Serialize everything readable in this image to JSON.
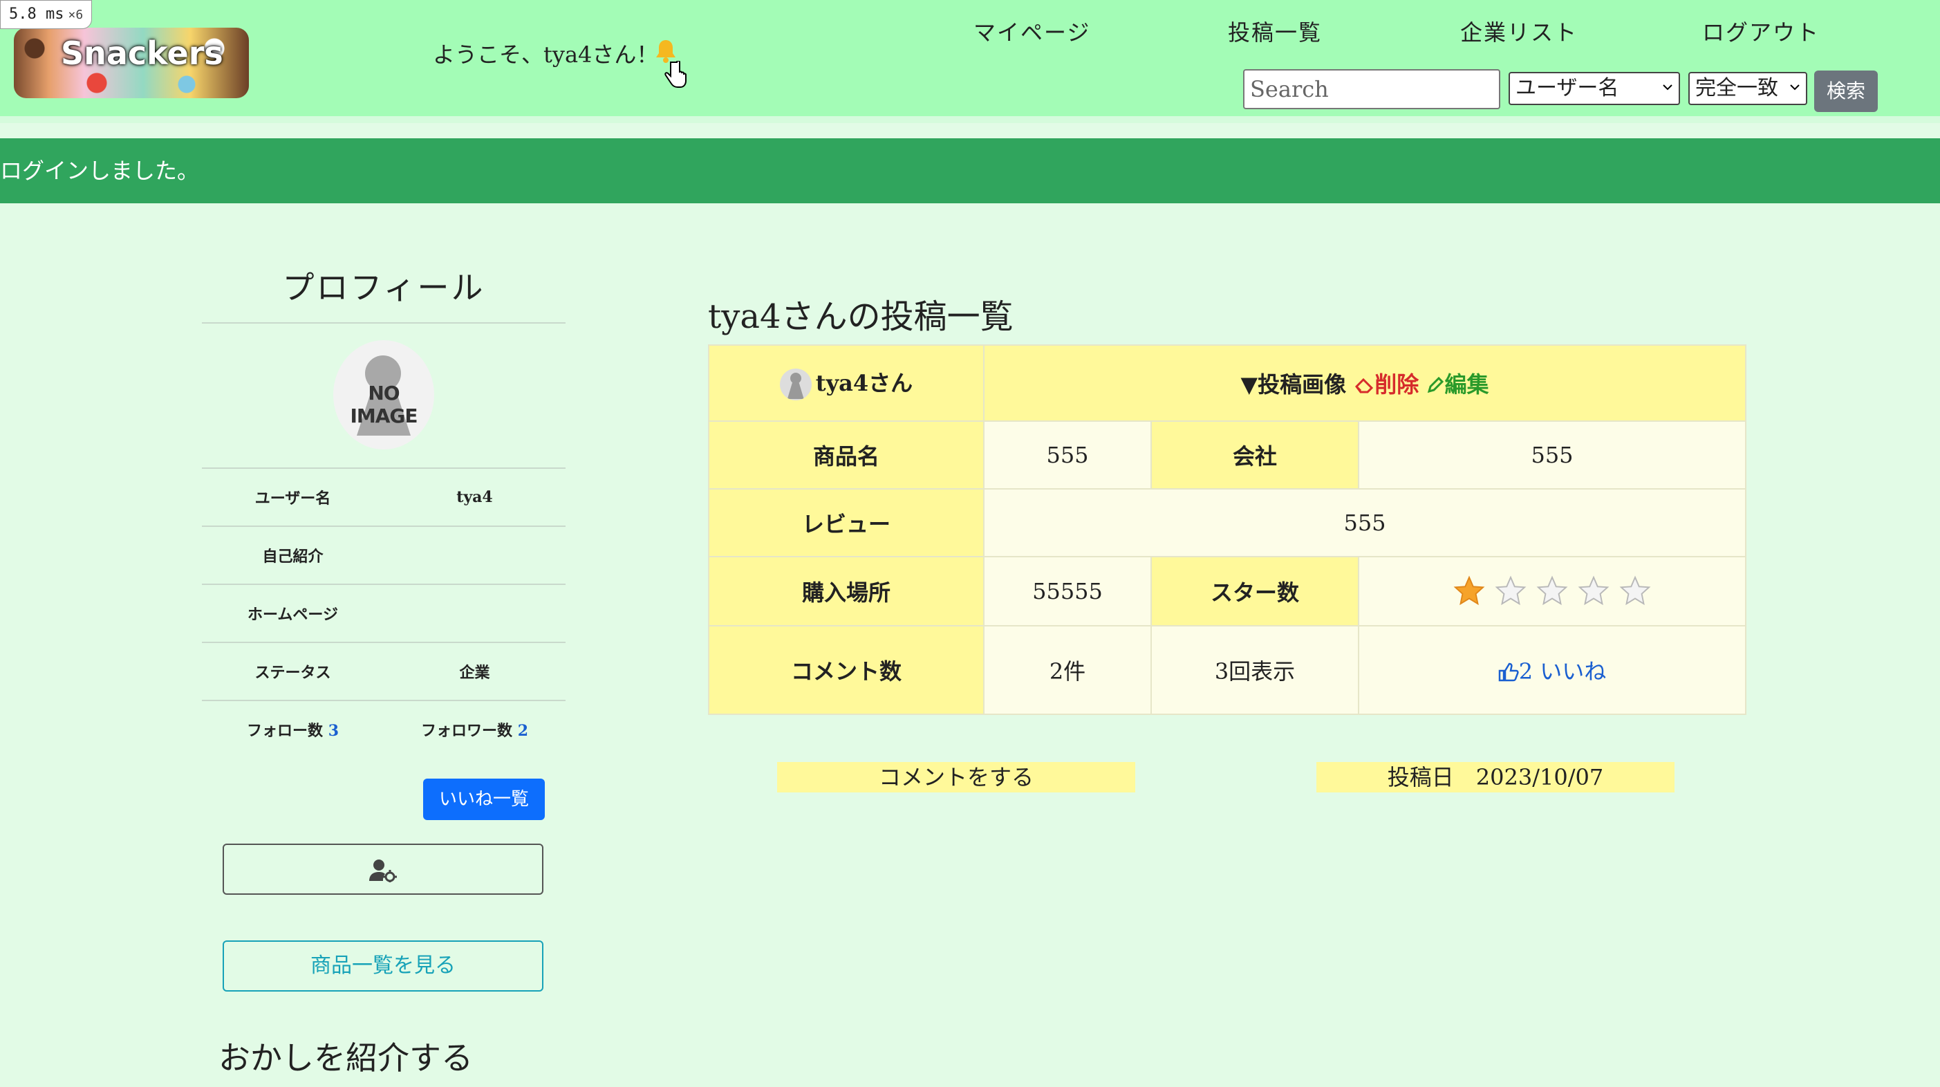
{
  "debug": {
    "timing": "5.8 ms",
    "multiplier": "×6"
  },
  "header": {
    "logo_text": "Snackers",
    "welcome": "ようこそ、tya4さん！",
    "nav": [
      "マイページ",
      "投稿一覧",
      "企業リスト",
      "ログアウト"
    ],
    "search": {
      "placeholder": "Search",
      "field_option": "ユーザー名",
      "match_option": "完全一致",
      "button": "検索"
    }
  },
  "flash": "ログインしました。",
  "sidebar": {
    "title": "プロフィール",
    "avatar_text": "NO IMAGE",
    "rows": {
      "username_label": "ユーザー名",
      "username_value": "tya4",
      "bio_label": "自己紹介",
      "bio_value": "",
      "homepage_label": "ホームページ",
      "homepage_value": "",
      "status_label": "ステータス",
      "status_value": "企業",
      "follow_label": "フォロー数",
      "follow_count": "3",
      "follower_label": "フォロワー数",
      "follower_count": "2"
    },
    "likes_button": "いいね一覧",
    "products_button": "商品一覧を見る",
    "intro_heading": "おかしを紹介する"
  },
  "main": {
    "title": "tya4さんの投稿一覧",
    "post": {
      "user": "tya4さん",
      "image_label": "▼投稿画像",
      "delete": "削除",
      "edit": "編集",
      "product_label": "商品名",
      "product_value": "555",
      "company_label": "会社",
      "company_value": "555",
      "review_label": "レビュー",
      "review_value": "555",
      "place_label": "購入場所",
      "place_value": "55555",
      "stars_label": "スター数",
      "stars": 1,
      "stars_max": 5,
      "comments_label": "コメント数",
      "comments_value": "2件",
      "views_value": "3回表示",
      "likes_value": "2 いいね"
    },
    "comment_tag": "コメントをする",
    "date_tag": "投稿日　2023/10/07"
  },
  "colors": {
    "header_bg": "#a3fcb6",
    "flash_bg": "#30a55d",
    "page_bg": "#e2fbe6",
    "table_head": "#fff99a",
    "primary": "#0d6efd"
  }
}
